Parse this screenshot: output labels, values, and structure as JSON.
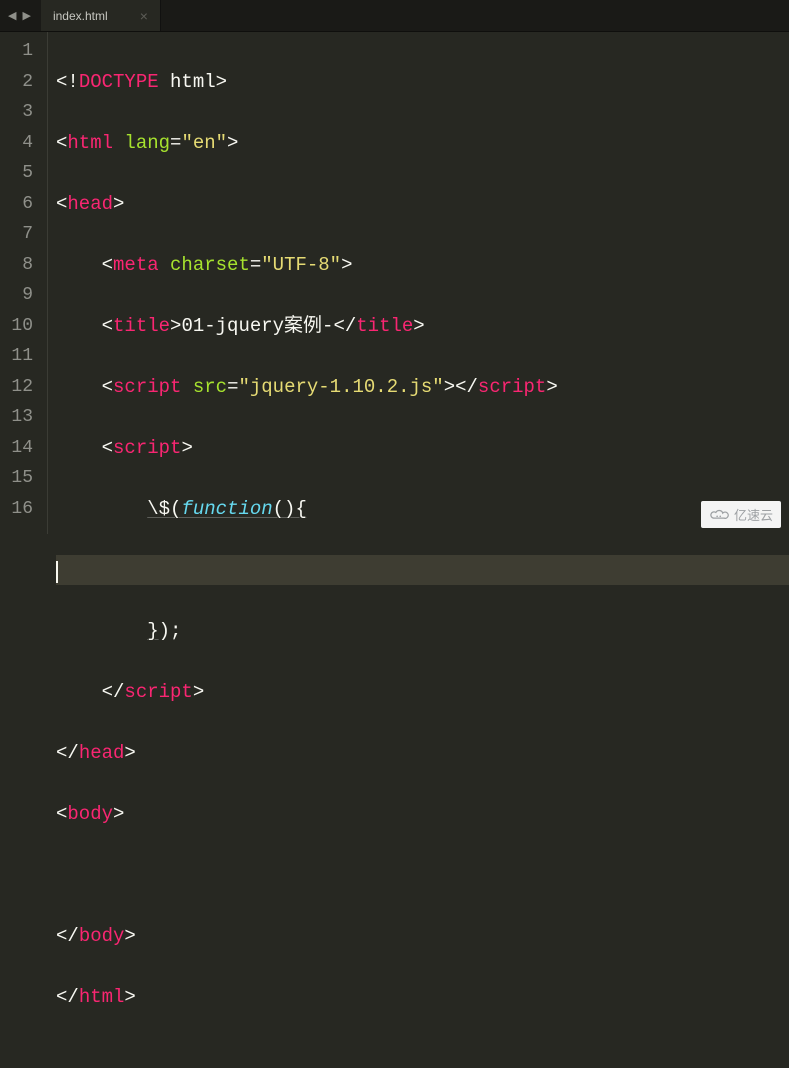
{
  "tab": {
    "title": "index.html",
    "close": "×"
  },
  "nav": {
    "left": "◀",
    "right": "▶"
  },
  "gutter": [
    "1",
    "2",
    "3",
    "4",
    "5",
    "6",
    "7",
    "8",
    "9",
    "10",
    "11",
    "12",
    "13",
    "14",
    "15",
    "16"
  ],
  "code": {
    "l1": {
      "a": "<!",
      "b": "DOCTYPE ",
      "c": "html",
      "d": ">"
    },
    "l2": {
      "a": "<",
      "b": "html ",
      "c": "lang",
      "d": "=",
      "e": "\"en\"",
      "f": ">"
    },
    "l3": {
      "a": "<",
      "b": "head",
      "c": ">"
    },
    "l4": {
      "i": "    ",
      "a": "<",
      "b": "meta ",
      "c": "charset",
      "d": "=",
      "e": "\"UTF-8\"",
      "f": ">"
    },
    "l5": {
      "i": "    ",
      "a": "<",
      "b": "title",
      "c": ">",
      "d": "01-jquery案例-",
      "e": "</",
      "f": "title",
      "g": ">"
    },
    "l6": {
      "i": "    ",
      "a": "<",
      "b": "script ",
      "c": "src",
      "d": "=",
      "e": "\"jquery-1.10.2.js\"",
      "f": ">",
      "g": "</",
      "h": "script",
      "j": ">"
    },
    "l7": {
      "i": "    ",
      "a": "<",
      "b": "script",
      "c": ">"
    },
    "l8": {
      "i": "        ",
      "a": "\\$",
      "b": "(",
      "c": "function",
      "d": "()",
      "e": "{"
    },
    "l9": {
      "i": ""
    },
    "l10": {
      "i": "        ",
      "a": "}",
      "b": ");"
    },
    "l11": {
      "i": "    ",
      "a": "</",
      "b": "script",
      "c": ">"
    },
    "l12": {
      "a": "</",
      "b": "head",
      "c": ">"
    },
    "l13": {
      "a": "<",
      "b": "body",
      "c": ">"
    },
    "l14": {
      "i": ""
    },
    "l15": {
      "a": "</",
      "b": "body",
      "c": ">"
    },
    "l16": {
      "a": "</",
      "b": "html",
      "c": ">"
    }
  },
  "watermark": {
    "text": "亿速云"
  }
}
